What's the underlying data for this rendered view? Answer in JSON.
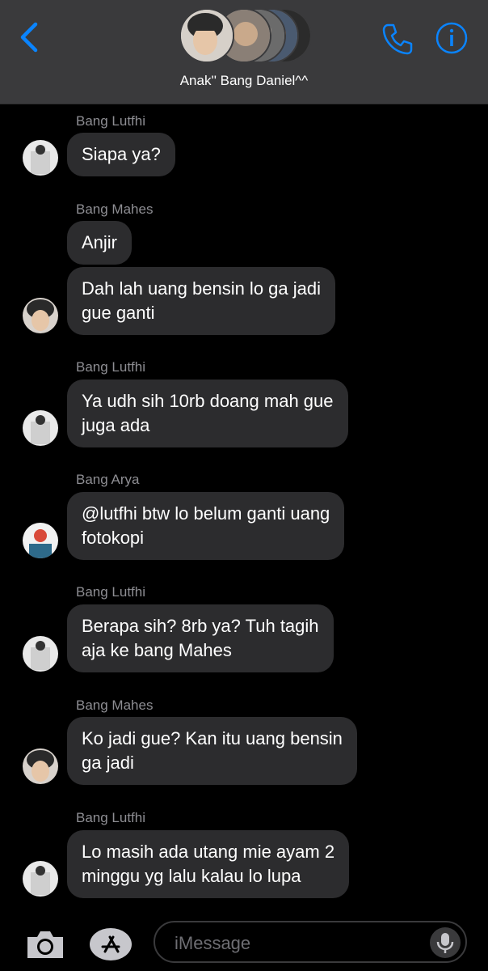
{
  "colors": {
    "accent": "#0a84ff",
    "bubble": "#2c2c2e",
    "sender": "#8e8e93",
    "header": "#3a3a3c"
  },
  "header": {
    "back_icon": "chevron-left-icon",
    "group_name": "Anak'' Bang Daniel^^",
    "call_icon": "phone-icon",
    "info_icon": "info-icon"
  },
  "messages": [
    {
      "sender": "Bang Lutfhi",
      "bubbles": [
        "Siapa ya?"
      ]
    },
    {
      "sender": "Bang Mahes",
      "bubbles": [
        "Anjir",
        "Dah lah uang bensin lo ga jadi\ngue ganti"
      ]
    },
    {
      "sender": "Bang Lutfhi",
      "bubbles": [
        "Ya udh sih 10rb doang mah gue\njuga ada"
      ]
    },
    {
      "sender": "Bang Arya",
      "bubbles": [
        "@lutfhi btw lo belum ganti uang\nfotokopi"
      ]
    },
    {
      "sender": "Bang Lutfhi",
      "bubbles": [
        "Berapa sih? 8rb ya? Tuh tagih\naja ke bang Mahes"
      ]
    },
    {
      "sender": "Bang Mahes",
      "bubbles": [
        "Ko jadi gue? Kan itu uang bensin\nga jadi"
      ]
    },
    {
      "sender": "Bang Lutfhi",
      "bubbles": [
        "Lo masih ada utang mie ayam 2\nminggu yg lalu kalau lo lupa"
      ]
    }
  ],
  "composer": {
    "camera_icon": "camera-icon",
    "apps_icon": "app-store-icon",
    "placeholder": "iMessage",
    "mic_icon": "microphone-icon"
  }
}
